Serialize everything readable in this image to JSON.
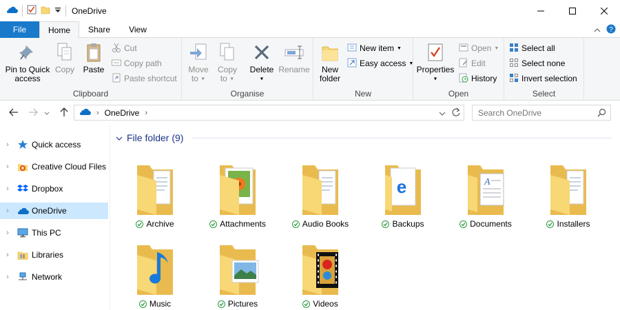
{
  "window": {
    "title": "OneDrive"
  },
  "tabs": {
    "file": "File",
    "home": "Home",
    "share": "Share",
    "view": "View"
  },
  "ribbon": {
    "clipboard": {
      "label": "Clipboard",
      "pin": [
        "Pin to Quick",
        "access"
      ],
      "copy": "Copy",
      "paste": "Paste",
      "cut": "Cut",
      "copy_path": "Copy path",
      "paste_shortcut": "Paste shortcut"
    },
    "organise": {
      "label": "Organise",
      "move_to": [
        "Move",
        "to"
      ],
      "copy_to": [
        "Copy",
        "to"
      ],
      "delete": "Delete",
      "rename": "Rename"
    },
    "new": {
      "label": "New",
      "new_folder": [
        "New",
        "folder"
      ],
      "new_item": "New item",
      "easy_access": "Easy access"
    },
    "open": {
      "label": "Open",
      "properties": "Properties",
      "open": "Open",
      "edit": "Edit",
      "history": "History"
    },
    "select": {
      "label": "Select",
      "select_all": "Select all",
      "select_none": "Select none",
      "invert_selection": "Invert selection"
    }
  },
  "address": {
    "crumb": "OneDrive"
  },
  "search": {
    "placeholder": "Search OneDrive"
  },
  "nav": {
    "items": [
      {
        "label": "Quick access",
        "icon": "star-icon"
      },
      {
        "label": "Creative Cloud Files",
        "icon": "creative-cloud-icon"
      },
      {
        "label": "Dropbox",
        "icon": "dropbox-icon"
      },
      {
        "label": "OneDrive",
        "icon": "onedrive-icon",
        "selected": true
      },
      {
        "label": "This PC",
        "icon": "computer-icon"
      },
      {
        "label": "Libraries",
        "icon": "libraries-icon"
      },
      {
        "label": "Network",
        "icon": "network-icon"
      }
    ]
  },
  "content": {
    "group_title": "File folder (9)",
    "folders": [
      {
        "name": "Archive",
        "overlay": "document"
      },
      {
        "name": "Attachments",
        "overlay": "photo"
      },
      {
        "name": "Audio Books",
        "overlay": "document"
      },
      {
        "name": "Backups",
        "overlay": "edge"
      },
      {
        "name": "Documents",
        "overlay": "text-document"
      },
      {
        "name": "Installers",
        "overlay": "document"
      },
      {
        "name": "Music",
        "overlay": "music-note"
      },
      {
        "name": "Pictures",
        "overlay": "landscape"
      },
      {
        "name": "Videos",
        "overlay": "film"
      }
    ]
  },
  "colors": {
    "accent": "#1979ca",
    "folder": "#f8d775",
    "selected": "#cce8ff",
    "sync_ok": "#2b9a3f"
  }
}
